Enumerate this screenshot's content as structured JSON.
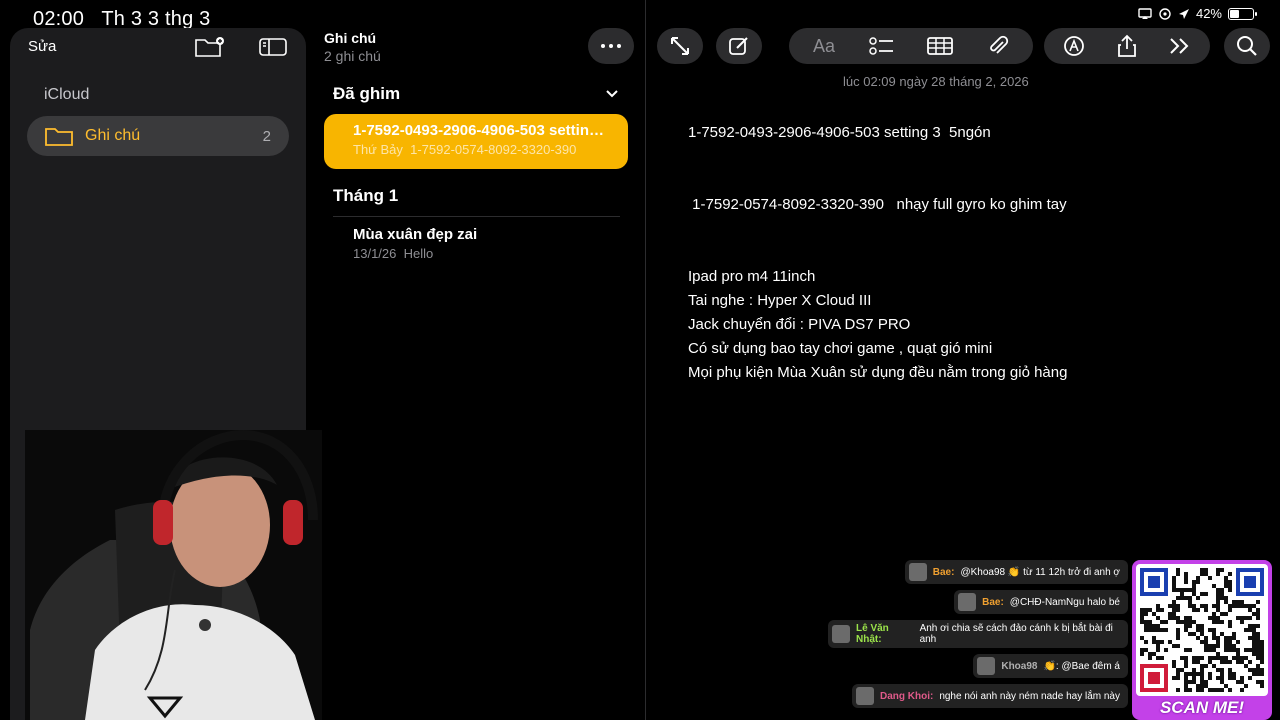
{
  "status_bar": {
    "time": "02:00",
    "date": "Th 3 3 thg 3",
    "battery": "42%",
    "battery_level": 0.42
  },
  "sidebar": {
    "edit_label": "Sửa",
    "section": "iCloud",
    "folder": {
      "name": "Ghi chú",
      "count": "2"
    }
  },
  "note_list": {
    "title": "Ghi chú",
    "subtitle": "2 ghi chú",
    "pinned_header": "Đã ghim",
    "pinned_note": {
      "title": "1-7592-0493-2906-4906-503 setting 3 5ngón",
      "date": "Thứ Bảy",
      "preview": "1-7592-0574-8092-3320-390"
    },
    "month_header": "Tháng 1",
    "note": {
      "title": "Mùa xuân đẹp zai",
      "date": "13/1/26",
      "preview": "Hello"
    }
  },
  "toolbar": {
    "format_label": "Aa"
  },
  "note": {
    "timestamp": "lúc 02:09 ngày 28 tháng 2, 2026",
    "lines": [
      "1-7592-0493-2906-4906-503 setting 3  5ngón",
      "",
      "",
      " 1-7592-0574-8092-3320-390   nhạy full gyro ko ghim tay",
      "",
      "",
      "Ipad pro m4 11inch",
      "Tai nghe : Hyper X Cloud III",
      "Jack chuyển đổi : PIVA DS7 PRO",
      "Có sử dụng bao tay chơi game , quạt gió mini",
      "Mọi phụ kiện Mùa Xuân sử dụng đều nằm trong giỏ hàng"
    ]
  },
  "chat": [
    {
      "name": "Bae:",
      "text": "@Khoa98 👏 từ 11 12h trở đi anh ợ",
      "color": "#f0a030"
    },
    {
      "name": "Bae:",
      "text": "@CHĐ-NamNgu halo bé",
      "color": "#f0a030"
    },
    {
      "name": "Lê Văn Nhật:",
      "text": "Anh ơi chia sẽ cách đảo cánh k bị bắt bài đi anh",
      "color": "#9be34a"
    },
    {
      "name": "Khoa98",
      "text": "👏: @Bae đêm á",
      "color": "#b0b0b0"
    },
    {
      "name": "Dang Khoi:",
      "text": "nghe nói anh này ném nade hay lắm này",
      "color": "#e05a8a"
    }
  ],
  "qr": {
    "label": "SCAN ME!"
  },
  "colors": {
    "accent": "#f8b500",
    "background": "#000000",
    "sidebar": "#1c1c1e"
  }
}
